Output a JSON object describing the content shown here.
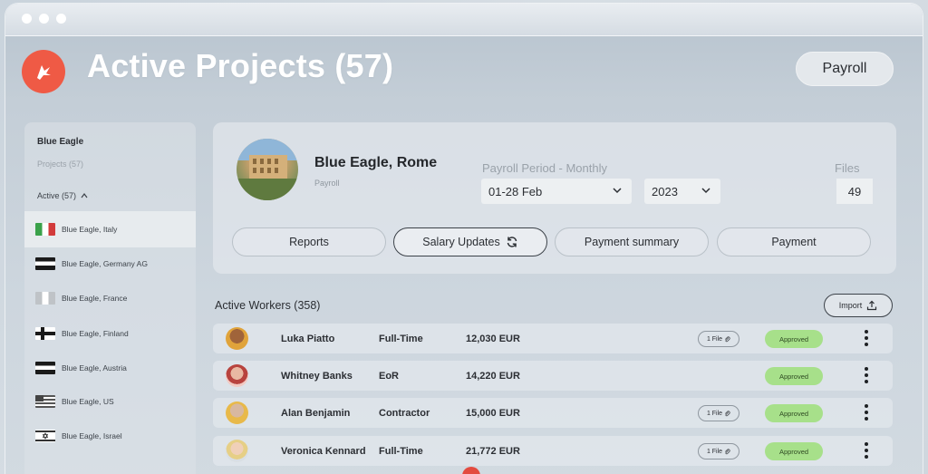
{
  "header": {
    "title": "Active Projects (57)",
    "payroll_button": "Payroll"
  },
  "sidebar": {
    "title": "Blue Eagle",
    "projects": "Projects (57)",
    "active": "Active (57)",
    "items": [
      {
        "label": "Blue Eagle, Italy",
        "flag": "italy-flag-icon"
      },
      {
        "label": "Blue Eagle, Germany AG",
        "flag": "germany-flag-icon"
      },
      {
        "label": "Blue Eagle, France",
        "flag": "france-flag-icon"
      },
      {
        "label": "Blue Eagle, Finland",
        "flag": "finland-flag-icon"
      },
      {
        "label": "Blue Eagle, Austria",
        "flag": "austria-flag-icon"
      },
      {
        "label": "Blue Eagle, US",
        "flag": "us-flag-icon"
      },
      {
        "label": "Blue Eagle, Israel",
        "flag": "israel-flag-icon"
      }
    ]
  },
  "project": {
    "name": "Blue Eagle, Rome",
    "subtitle": "Payroll",
    "period_label": "Payroll Period - Monthly",
    "period_value": "01-28 Feb",
    "year_value": "2023",
    "files_label": "Files",
    "files_value": "49",
    "tabs": [
      "Reports",
      "Salary Updates",
      "Payment summary",
      "Payment"
    ]
  },
  "workers": {
    "title": "Active Workers (358)",
    "import_label": "Import",
    "rows": [
      {
        "name": "Luka Piatto",
        "type": "Full-Time",
        "salary": "12,030 EUR",
        "file": "1 File",
        "status": "Approved"
      },
      {
        "name": "Whitney Banks",
        "type": "EoR",
        "salary": "14,220 EUR",
        "file": "",
        "status": "Approved"
      },
      {
        "name": "Alan Benjamin",
        "type": "Contractor",
        "salary": "15,000 EUR",
        "file": "1 File",
        "status": "Approved"
      },
      {
        "name": "Veronica Kennard",
        "type": "Full-Time",
        "salary": "21,772 EUR",
        "file": "1 File",
        "status": "Approved"
      }
    ]
  },
  "colors": {
    "brand": "#ef5a45",
    "approved": "#a7e08a"
  }
}
